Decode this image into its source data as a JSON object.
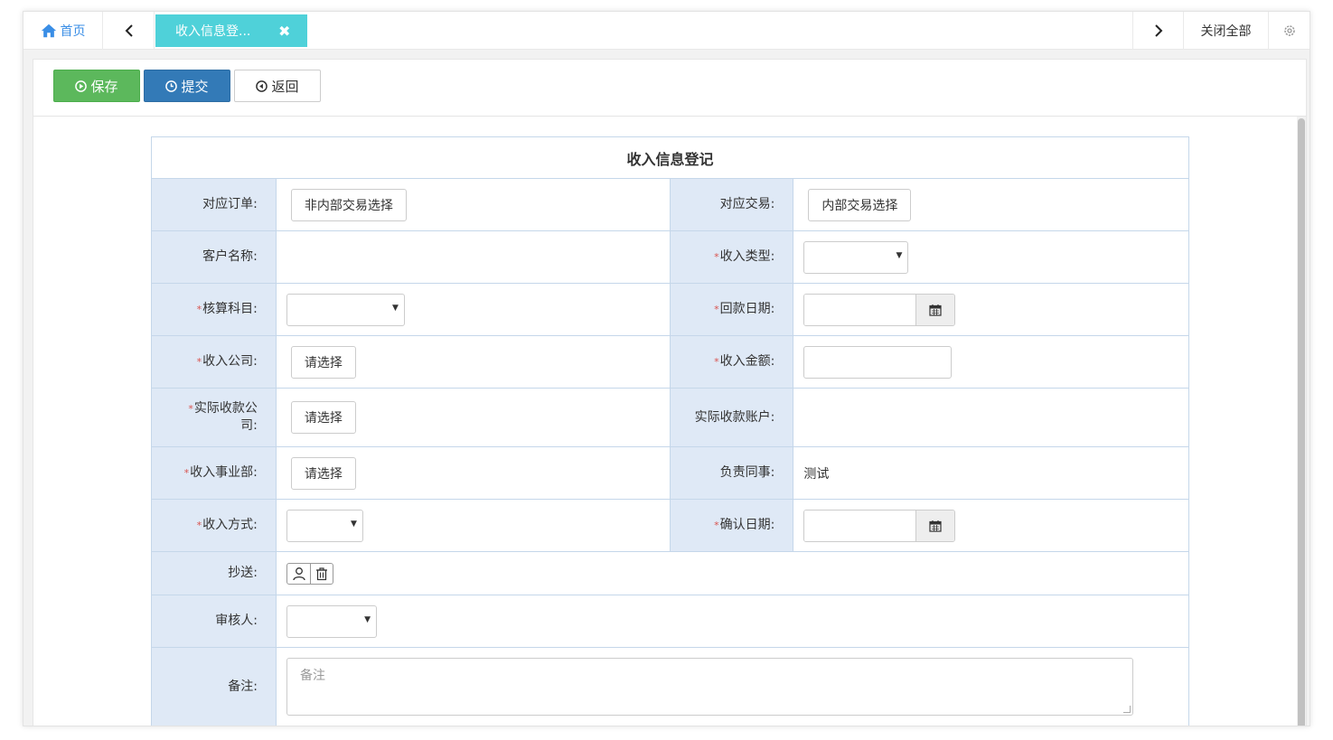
{
  "tabs": {
    "home_label": "首页",
    "active_tab_label": "收入信息登...",
    "close_symbol": "✖",
    "close_all_label": "关闭全部"
  },
  "toolbar": {
    "save_label": "保存",
    "submit_label": "提交",
    "back_label": "返回"
  },
  "form": {
    "title": "收入信息登记",
    "rows": {
      "order_label": "对应订单:",
      "order_button": "非内部交易选择",
      "transaction_label": "对应交易:",
      "transaction_button": "内部交易选择",
      "customer_label": "客户名称:",
      "income_type_label": "收入类型:",
      "account_subject_label": "核算科目:",
      "payment_date_label": "回款日期:",
      "income_company_label": "收入公司:",
      "income_company_button": "请选择",
      "income_amount_label": "收入金额:",
      "actual_company_label_1": "实际收款公",
      "actual_company_label_2": "司:",
      "actual_company_button": "请选择",
      "actual_account_label": "实际收款账户:",
      "division_label": "收入事业部:",
      "division_button": "请选择",
      "responsible_label": "负责同事:",
      "responsible_value": "测试",
      "income_method_label": "收入方式:",
      "confirm_date_label": "确认日期:",
      "cc_label": "抄送:",
      "reviewer_label": "审核人:",
      "remarks_label": "备注:",
      "remarks_placeholder": "备注"
    },
    "required_mark": "*"
  },
  "colors": {
    "tab_active": "#4fd1d9",
    "save_button": "#5cb85c",
    "submit_button": "#337ab7",
    "label_bg": "#dfe9f6",
    "home_link": "#3a8ee6",
    "required": "#d9534f"
  },
  "icons": [
    "home-icon",
    "chevron-left-icon",
    "chevron-right-icon",
    "gear-icon",
    "play-circle-icon",
    "clock-circle-icon",
    "back-circle-icon",
    "calendar-icon",
    "user-icon",
    "trash-icon"
  ]
}
